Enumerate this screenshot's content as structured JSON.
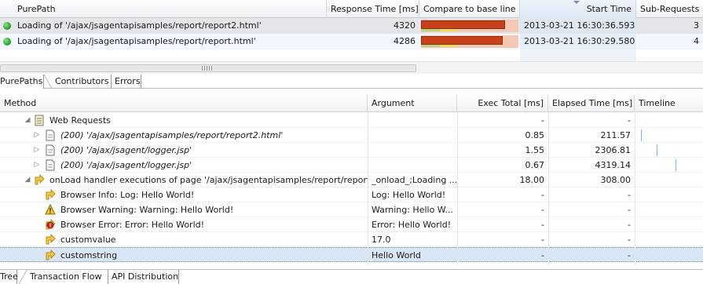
{
  "purepath_table": {
    "columns": [
      "PurePath",
      "Response Time [ms]",
      "Compare to base line",
      "Start Time",
      "Sub-Requests"
    ],
    "rows": [
      {
        "name": "Loading of '/ajax/jsagentapisamples/report/report2.html'",
        "response_time": "4320",
        "start_time": "2013-03-21 16:30:36.593",
        "sub_requests": "3",
        "baseline_fill": 0.86
      },
      {
        "name": "Loading of '/ajax/jsagentapisamples/report/report.html'",
        "response_time": "4286",
        "start_time": "2013-03-21 16:30:29.580",
        "sub_requests": "4",
        "baseline_fill": 0.84
      }
    ],
    "status_color": "#22a022",
    "bar_color": "#c8411a"
  },
  "top_tabs": [
    "PurePaths",
    "Contributors",
    "Errors"
  ],
  "method_table": {
    "columns": [
      "Method",
      "Argument",
      "Exec Total [ms]",
      "Elapsed Time [ms]",
      "Timeline"
    ],
    "rows": [
      {
        "method": "Web Requests",
        "argument": "",
        "exec": "-",
        "elapsed": "-",
        "icon": "document-icon",
        "expander": "expanded"
      },
      {
        "method": "(200) '/ajax/jsagentapisamples/report/report2.html'",
        "argument": "",
        "exec": "0.85",
        "elapsed": "211.57",
        "icon": "page-icon",
        "expander": "collapsed"
      },
      {
        "method": "(200) '/ajax/jsagent/logger.jsp'",
        "argument": "",
        "exec": "1.55",
        "elapsed": "2306.81",
        "icon": "page-icon",
        "expander": "collapsed"
      },
      {
        "method": "(200) '/ajax/jsagent/logger.jsp'",
        "argument": "",
        "exec": "0.67",
        "elapsed": "4319.14",
        "icon": "page-icon",
        "expander": "collapsed"
      },
      {
        "method": "onLoad handler executions of page '/ajax/jsagentapisamples/report/report",
        "argument": "_onload_;Loading ...",
        "exec": "18.00",
        "elapsed": "308.00",
        "icon": "handler-icon",
        "expander": "expanded"
      },
      {
        "method": "Browser Info: Log: Hello World!",
        "argument": "Log: Hello World!",
        "exec": "-",
        "elapsed": "-",
        "icon": "info-icon"
      },
      {
        "method": "Browser Warning: Warning: Hello World!",
        "argument": "Warning: Hello W...",
        "exec": "-",
        "elapsed": "-",
        "icon": "warning-icon"
      },
      {
        "method": "Browser Error: Error: Hello World!",
        "argument": "Error: Hello World!",
        "exec": "-",
        "elapsed": "-",
        "icon": "error-icon"
      },
      {
        "method": "customvalue",
        "argument": "17.0",
        "exec": "-",
        "elapsed": "-",
        "icon": "handler-icon"
      },
      {
        "method": "customstring",
        "argument": "Hello World",
        "exec": "-",
        "elapsed": "-",
        "icon": "handler-icon",
        "selected": true
      }
    ]
  },
  "bottom_tabs": [
    "Tree",
    "Transaction Flow",
    "API Distribution"
  ]
}
